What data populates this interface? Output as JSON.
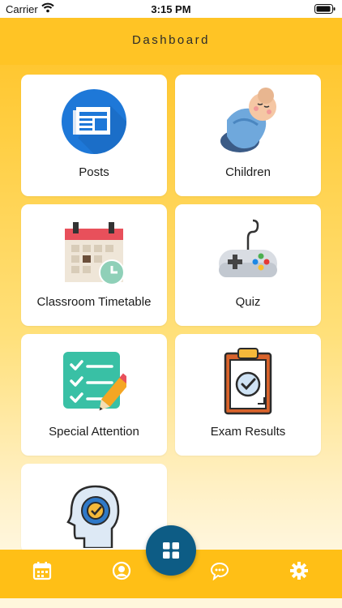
{
  "status_bar": {
    "carrier": "Carrier",
    "time": "3:15 PM"
  },
  "header": {
    "title": "Dashboard"
  },
  "cards": [
    {
      "label": "Posts",
      "icon": "newspaper-icon"
    },
    {
      "label": "Children",
      "icon": "baby-icon"
    },
    {
      "label": "Classroom Timetable",
      "icon": "calendar-clock-icon"
    },
    {
      "label": "Quiz",
      "icon": "gamepad-icon"
    },
    {
      "label": "Special Attention",
      "icon": "checklist-pencil-icon"
    },
    {
      "label": "Exam Results",
      "icon": "clipboard-check-icon"
    },
    {
      "label": "",
      "icon": "head-gear-icon"
    }
  ],
  "tabbar": {
    "items": [
      "calendar-icon",
      "profile-icon",
      "chat-icon",
      "settings-icon"
    ],
    "center": "grid-icon"
  },
  "colors": {
    "accent": "#ffc425",
    "fab": "#0d5c85"
  }
}
